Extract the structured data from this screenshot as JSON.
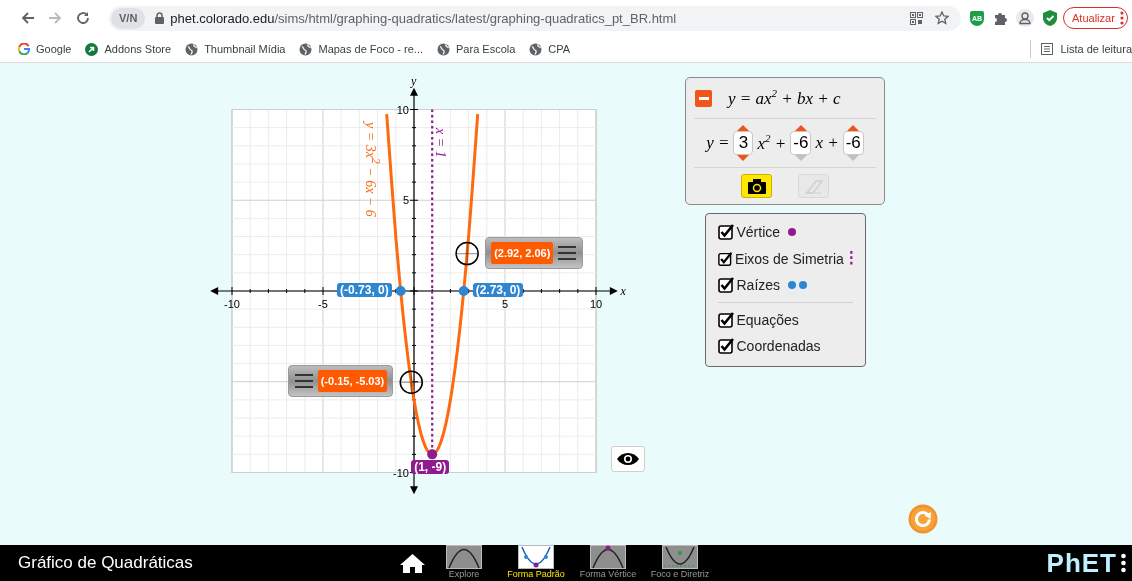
{
  "browser": {
    "nav_buttons": [
      {
        "kind": "back",
        "disabled": false
      },
      {
        "kind": "forward",
        "disabled": true
      },
      {
        "kind": "reload",
        "disabled": false
      }
    ],
    "vpn_badge": "V/N",
    "url_host": "phet.colorado.edu",
    "url_path": "/sims/html/graphing-quadratics/latest/graphing-quadratics_pt_BR.html",
    "extension_badge": "AB",
    "update_button": "Atualizar",
    "bookmarks": [
      {
        "label": "Google",
        "kind": "google"
      },
      {
        "label": "Addons Store",
        "kind": "store"
      },
      {
        "label": "Thumbnail Mídia",
        "kind": "globe"
      },
      {
        "label": "Mapas de Foco - re...",
        "kind": "globe"
      },
      {
        "label": "Para Escola",
        "kind": "globe"
      },
      {
        "label": "CPA",
        "kind": "globe"
      }
    ],
    "reading_list": "Lista de leitura"
  },
  "graph": {
    "chart_data": {
      "type": "line",
      "grid": true,
      "xlabel": "x",
      "ylabel": "y",
      "x": [
        -1.5,
        -1,
        -0.5,
        0,
        0.5,
        1,
        1.5,
        2,
        2.5,
        3,
        3.5
      ],
      "series": [
        {
          "name": "y = 3x$^{2}$ − 6x − 6",
          "color": "#ff6a10",
          "values": [
            9.75,
            3,
            -2.25,
            -6,
            -8.25,
            -9,
            -8.25,
            -6,
            -2.25,
            3,
            9.75
          ]
        }
      ],
      "xlim": [
        -10,
        10
      ],
      "ylim": [
        -10,
        10
      ],
      "xticks": [
        -10,
        -5,
        5,
        10
      ],
      "yticks": [
        -10,
        5,
        10
      ],
      "ref_lines": [
        {
          "axis": "x",
          "value": 1,
          "label": "x = 1",
          "color": "#8e1c8e"
        }
      ],
      "annotations": [
        {
          "text": "(-0.73, 0)",
          "x": -0.73,
          "y": 0
        },
        {
          "text": "(2.73, 0)",
          "x": 2.73,
          "y": 0
        },
        {
          "text": "(1, -9)",
          "x": 1,
          "y": -9
        },
        {
          "text": "(2.92, 2.06)",
          "x": 2.92,
          "y": 2.06
        },
        {
          "text": "(-0.15, -5.03)",
          "x": -0.15,
          "y": -5.03
        }
      ]
    }
  },
  "equation_panel": {
    "expanded": true,
    "formula": "y = ax$^{2}$ + bx + c",
    "terms": [
      {
        "kind": "text",
        "text": "y ="
      },
      {
        "kind": "spinner",
        "value": "3",
        "up_enabled": true,
        "down_enabled": true
      },
      {
        "kind": "text",
        "text": "x$^{2}$ +"
      },
      {
        "kind": "spinner",
        "value": "-6",
        "up_enabled": true,
        "down_enabled": false
      },
      {
        "kind": "text",
        "text": "x +"
      },
      {
        "kind": "spinner",
        "value": "-6",
        "up_enabled": true,
        "down_enabled": false
      }
    ],
    "buttons": [
      {
        "kind": "camera",
        "disabled": false
      },
      {
        "kind": "eraser",
        "disabled": true
      }
    ]
  },
  "checkbox_groups": [
    {
      "items": [
        {
          "label": "Vértice",
          "checked": true,
          "kind": "dot",
          "color": "#8e1c8e"
        },
        {
          "label": "Eixos de Simetria",
          "checked": true,
          "kind": "dashed_line",
          "color": "#8e1c8e"
        },
        {
          "label": "Raízes",
          "checked": true,
          "kind": "two_dots",
          "color": "#2f86d0"
        }
      ]
    },
    {
      "items": [
        {
          "label": "Equações",
          "checked": true,
          "kind": "plain"
        },
        {
          "label": "Coordenadas",
          "checked": true,
          "kind": "plain"
        }
      ]
    }
  ],
  "navbar": {
    "title": "Gráfico de Quadráticas",
    "screens": [
      {
        "label": "Explore",
        "kind": "explore",
        "selected": false
      },
      {
        "label": "Forma Padrão",
        "kind": "standard",
        "selected": true
      },
      {
        "label": "Forma Vértice",
        "kind": "vertex",
        "selected": false
      },
      {
        "label": "Foco e Diretriz",
        "kind": "focus",
        "selected": false
      }
    ],
    "logo": "PhET"
  }
}
